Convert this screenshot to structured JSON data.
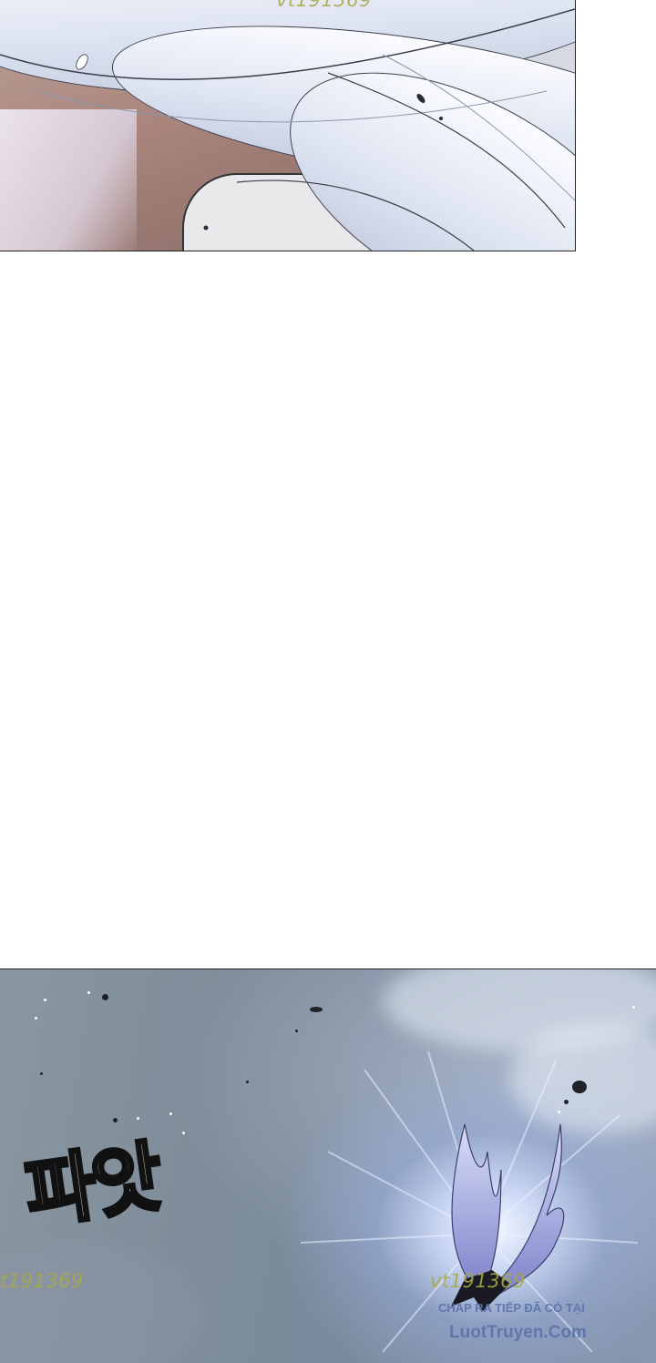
{
  "watermarks": {
    "top": "vt191369",
    "bottom_left": "t191369",
    "bottom_right": "vt191369"
  },
  "panels": {
    "bottom": {
      "sound_effect": "파앗",
      "credit": {
        "line1": "CHAP RA TIẾP ĐÃ CÓ TẠI",
        "line2": "LuotTruyen.Com"
      }
    }
  },
  "colors": {
    "gutter": "#ffffff",
    "panel_border": "#222222",
    "watermark": "#a8a848",
    "credit": "#5a72a8",
    "sky": "#7f8d9a",
    "glow": "#f4f8ff"
  }
}
